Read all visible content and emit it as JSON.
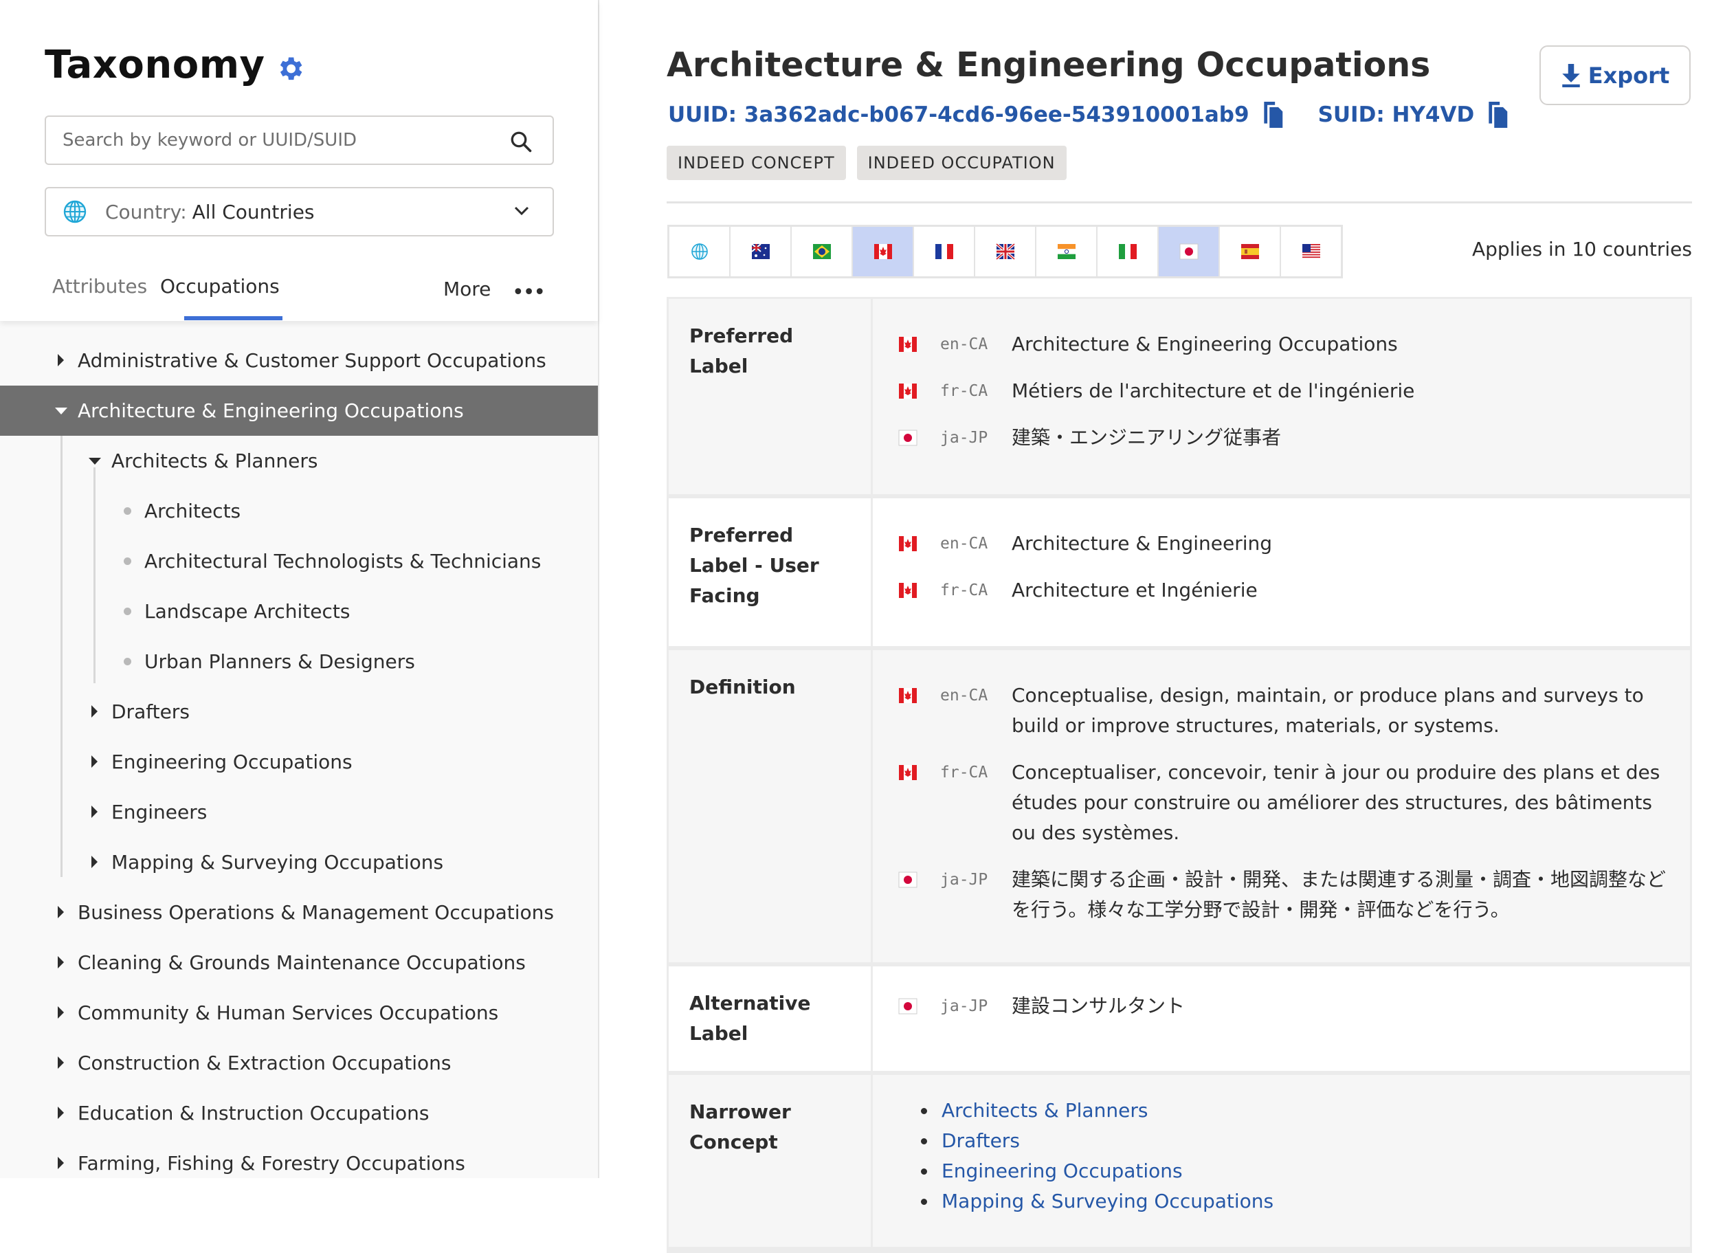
{
  "sidebar": {
    "title": "Taxonomy",
    "search": {
      "placeholder": "Search by keyword or UUID/SUID",
      "value": ""
    },
    "country": {
      "label": "Country:",
      "value": "All Countries"
    },
    "tabs": [
      {
        "label": "Attributes",
        "active": false
      },
      {
        "label": "Occupations",
        "active": true
      }
    ],
    "more_label": "More",
    "more_dots": "•••",
    "tree": [
      {
        "label": "Administrative & Customer Support Occupations",
        "level": 0,
        "type": "collapsed"
      },
      {
        "label": "Architecture & Engineering Occupations",
        "level": 0,
        "type": "expanded",
        "selected": true
      },
      {
        "label": "Architects & Planners",
        "level": 1,
        "type": "expanded"
      },
      {
        "label": "Architects",
        "level": 2,
        "type": "leaf"
      },
      {
        "label": "Architectural Technologists & Technicians",
        "level": 2,
        "type": "leaf"
      },
      {
        "label": "Landscape Architects",
        "level": 2,
        "type": "leaf"
      },
      {
        "label": "Urban Planners & Designers",
        "level": 2,
        "type": "leaf"
      },
      {
        "label": "Drafters",
        "level": 1,
        "type": "collapsed"
      },
      {
        "label": "Engineering Occupations",
        "level": 1,
        "type": "collapsed"
      },
      {
        "label": "Engineers",
        "level": 1,
        "type": "collapsed"
      },
      {
        "label": "Mapping & Surveying Occupations",
        "level": 1,
        "type": "collapsed"
      },
      {
        "label": "Business Operations & Management Occupations",
        "level": 0,
        "type": "collapsed"
      },
      {
        "label": "Cleaning & Grounds Maintenance Occupations",
        "level": 0,
        "type": "collapsed"
      },
      {
        "label": "Community & Human Services Occupations",
        "level": 0,
        "type": "collapsed"
      },
      {
        "label": "Construction & Extraction Occupations",
        "level": 0,
        "type": "collapsed"
      },
      {
        "label": "Education & Instruction Occupations",
        "level": 0,
        "type": "collapsed"
      },
      {
        "label": "Farming, Fishing & Forestry Occupations",
        "level": 0,
        "type": "collapsed"
      }
    ]
  },
  "main": {
    "title": "Architecture & Engineering Occupations",
    "export_label": "Export",
    "uuid": "UUID: 3a362adc-b067-4cd6-96ee-543910001ab9",
    "suid": "SUID: HY4VD",
    "badges": [
      "INDEED CONCEPT",
      "INDEED OCCUPATION"
    ],
    "flags": [
      {
        "country": "all",
        "icon": "globe-icon",
        "selected": false
      },
      {
        "country": "AU",
        "icon": "flag-australia-icon",
        "selected": false
      },
      {
        "country": "BR",
        "icon": "flag-brazil-icon",
        "selected": false
      },
      {
        "country": "CA",
        "icon": "flag-canada-icon",
        "selected": true
      },
      {
        "country": "FR",
        "icon": "flag-france-icon",
        "selected": false
      },
      {
        "country": "GB",
        "icon": "flag-uk-icon",
        "selected": false
      },
      {
        "country": "IN",
        "icon": "flag-india-icon",
        "selected": false
      },
      {
        "country": "IT",
        "icon": "flag-italy-icon",
        "selected": false
      },
      {
        "country": "JP",
        "icon": "flag-japan-icon",
        "selected": true
      },
      {
        "country": "ES",
        "icon": "flag-spain-icon",
        "selected": false
      },
      {
        "country": "US",
        "icon": "flag-usa-icon",
        "selected": false
      }
    ],
    "applies_text": "Applies in 10 countries",
    "rows": [
      {
        "label": "Preferred Label",
        "entries": [
          {
            "flag": "CA",
            "lang": "en-CA",
            "text": "Architecture & Engineering Occupations"
          },
          {
            "flag": "CA",
            "lang": "fr-CA",
            "text": "Métiers de l'architecture et de l'ingénierie"
          },
          {
            "flag": "JP",
            "lang": "ja-JP",
            "text": "建築・エンジニアリング従事者"
          }
        ]
      },
      {
        "label": "Preferred Label - User Facing",
        "entries": [
          {
            "flag": "CA",
            "lang": "en-CA",
            "text": "Architecture & Engineering"
          },
          {
            "flag": "CA",
            "lang": "fr-CA",
            "text": "Architecture et Ingénierie"
          }
        ]
      },
      {
        "label": "Definition",
        "entries": [
          {
            "flag": "CA",
            "lang": "en-CA",
            "text": "Conceptualise, design, maintain, or produce plans and surveys to build or improve structures, materials, or systems."
          },
          {
            "flag": "CA",
            "lang": "fr-CA",
            "text": "Conceptualiser, concevoir, tenir à jour ou produire des plans et des études pour construire ou améliorer des structures, des bâtiments ou des systèmes."
          },
          {
            "flag": "JP",
            "lang": "ja-JP",
            "text": "建築に関する企画・設計・開発、または関連する測量・調査・地図調整などを行う。様々な工学分野で設計・開発・評価などを行う。"
          }
        ]
      },
      {
        "label": "Alternative Label",
        "entries": [
          {
            "flag": "JP",
            "lang": "ja-JP",
            "text": "建設コンサルタント"
          }
        ]
      }
    ],
    "narrower": {
      "label": "Narrower Concept",
      "items": [
        "Architects & Planners",
        "Drafters",
        "Engineering Occupations",
        "Mapping & Surveying Occupations"
      ]
    }
  },
  "colors": {
    "accent": "#2557a7",
    "tab_underline": "#3d6fd6",
    "gear": "#3d6fd6",
    "selected_row": "#6f6f6f",
    "flag_selected_bg": "#c8d4f5"
  }
}
